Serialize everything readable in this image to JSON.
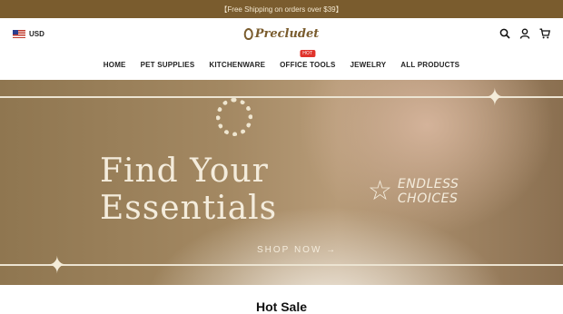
{
  "announcement": "【Free Shipping on orders over $39】",
  "header": {
    "currency": "USD",
    "logo": "Precludet"
  },
  "nav": {
    "items": [
      "HOME",
      "PET SUPPLIES",
      "KITCHENWARE",
      "OFFICE TOOLS",
      "JEWELRY",
      "ALL PRODUCTS"
    ],
    "hot_badge": "HOT"
  },
  "hero": {
    "title_line1": "Find Your",
    "title_line2": "Essentials",
    "tagline_line1": "ENDLESS",
    "tagline_line2": "CHOICES",
    "cta": "SHOP NOW →"
  },
  "section_title": "Hot Sale",
  "colors": {
    "brand": "#7a5c2e",
    "badge": "#e0342c"
  }
}
